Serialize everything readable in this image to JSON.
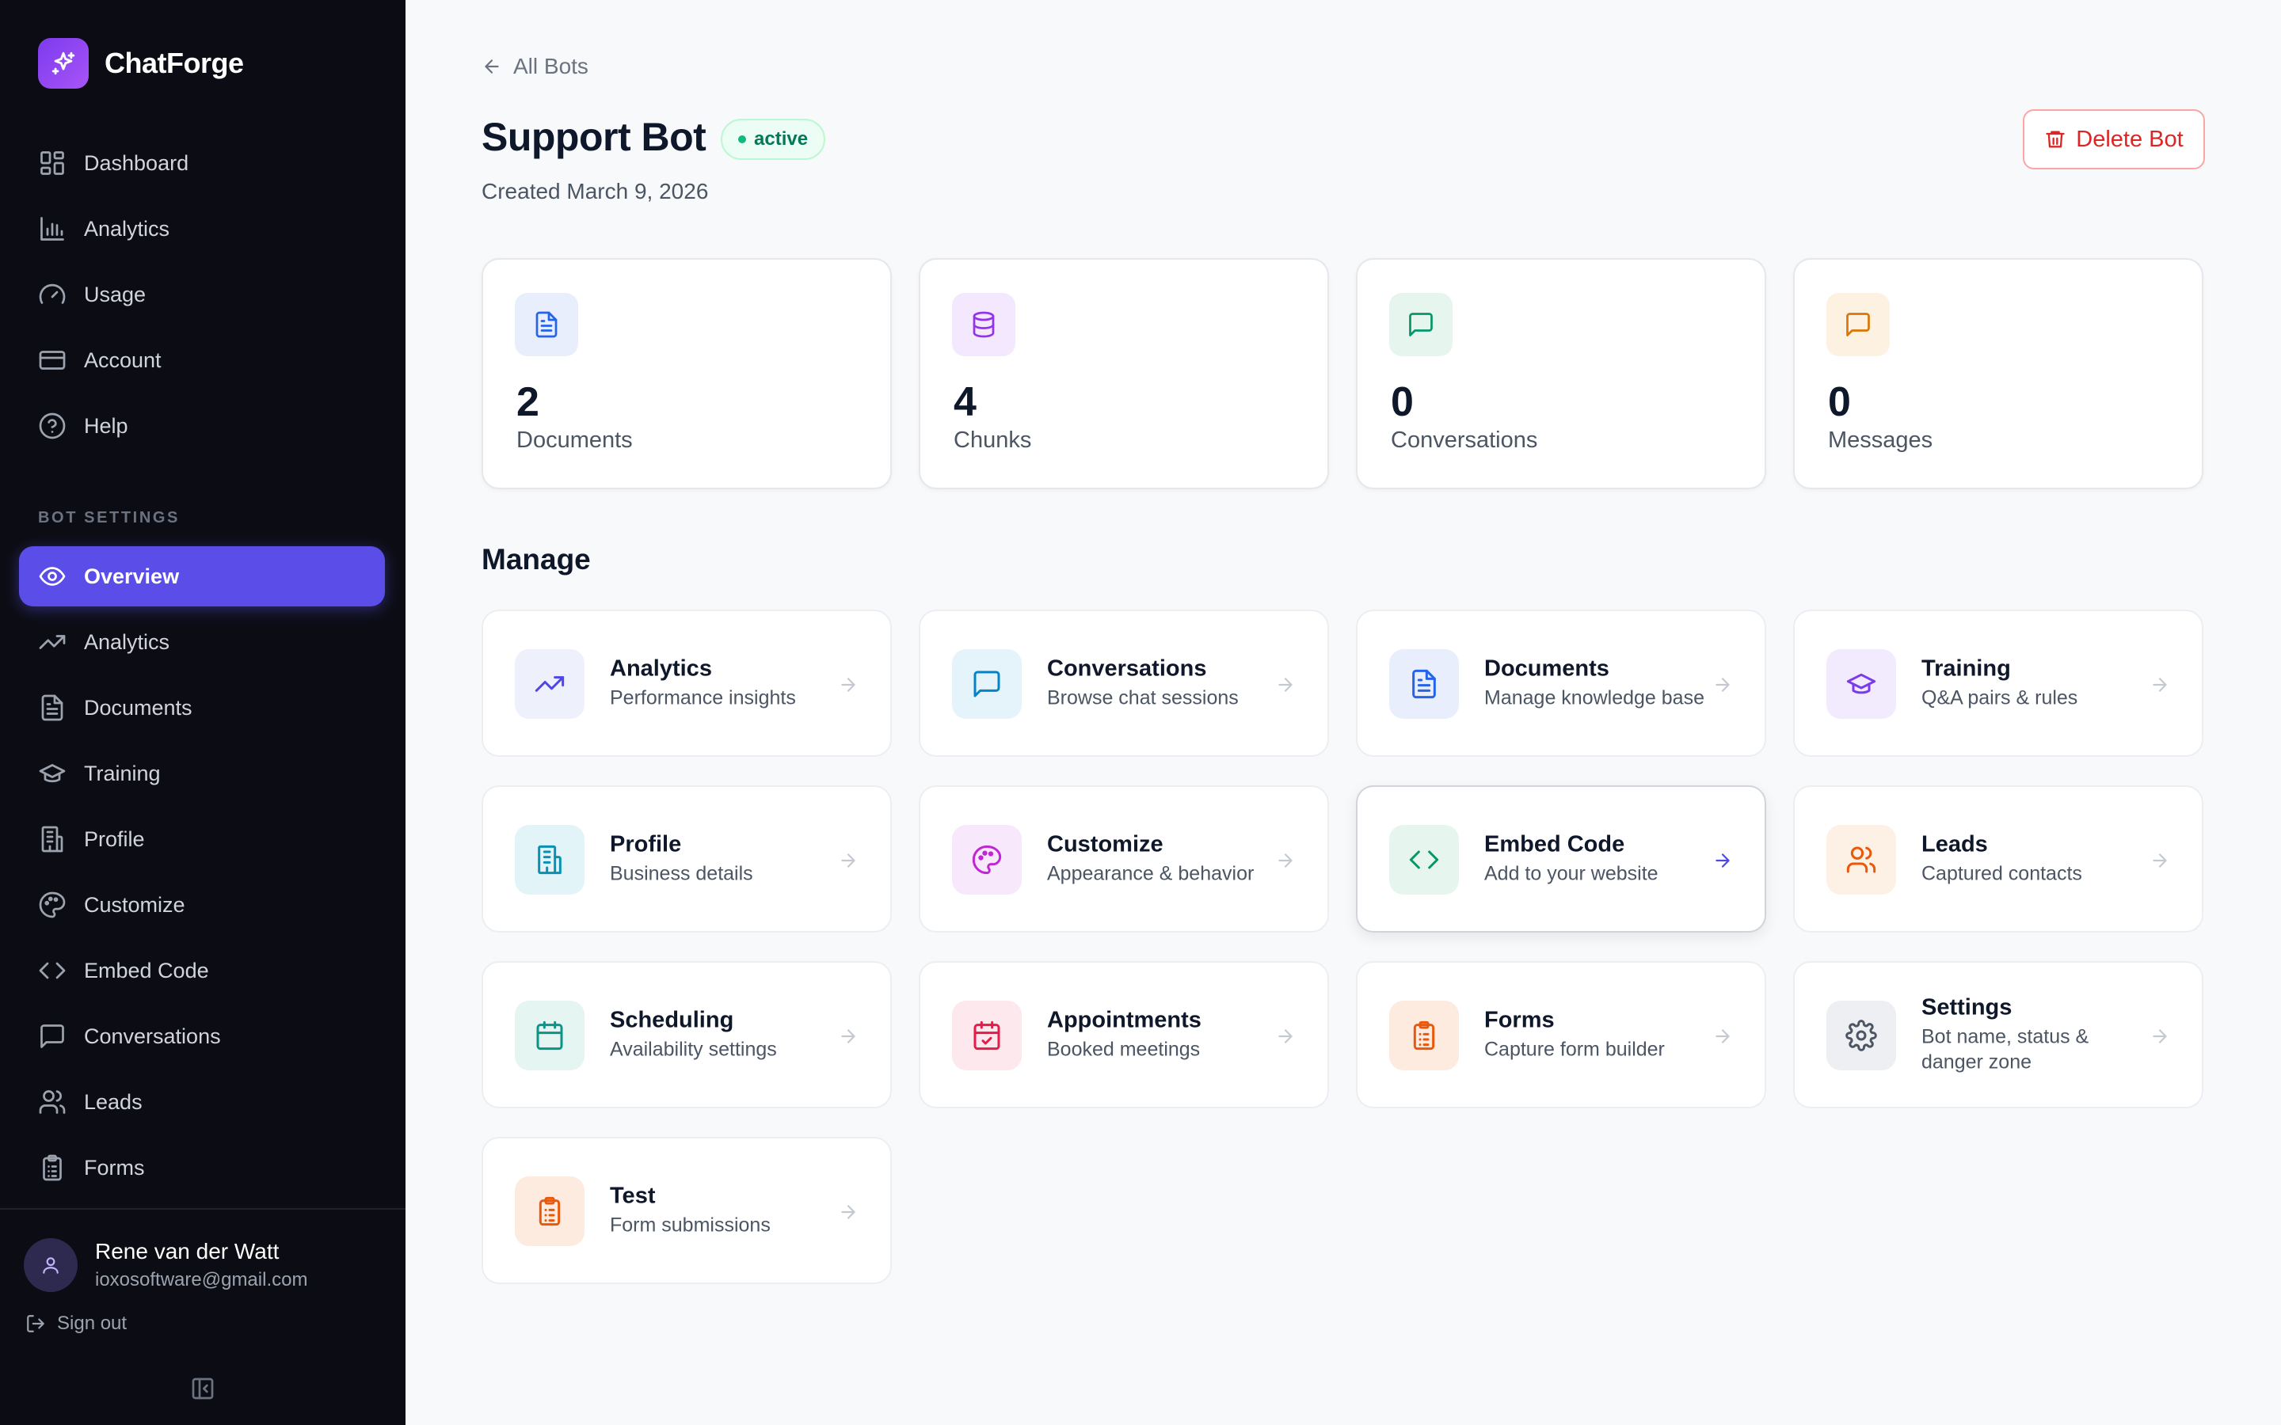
{
  "brand": {
    "name": "ChatForge"
  },
  "sidebar": {
    "top_items": [
      {
        "label": "Dashboard",
        "icon": "grid-icon"
      },
      {
        "label": "Analytics",
        "icon": "bar-chart-icon"
      },
      {
        "label": "Usage",
        "icon": "gauge-icon"
      },
      {
        "label": "Account",
        "icon": "credit-card-icon"
      },
      {
        "label": "Help",
        "icon": "help-circle-icon"
      }
    ],
    "section_label": "BOT SETTINGS",
    "bot_items": [
      {
        "label": "Overview",
        "icon": "eye-icon",
        "active": true
      },
      {
        "label": "Analytics",
        "icon": "trending-up-icon"
      },
      {
        "label": "Documents",
        "icon": "file-text-icon"
      },
      {
        "label": "Training",
        "icon": "graduation-cap-icon"
      },
      {
        "label": "Profile",
        "icon": "building-icon"
      },
      {
        "label": "Customize",
        "icon": "palette-icon"
      },
      {
        "label": "Embed Code",
        "icon": "code-icon"
      },
      {
        "label": "Conversations",
        "icon": "message-square-icon"
      },
      {
        "label": "Leads",
        "icon": "users-icon"
      },
      {
        "label": "Forms",
        "icon": "clipboard-list-icon"
      }
    ],
    "user": {
      "name": "Rene van der Watt",
      "email": "ioxosoftware@gmail.com"
    },
    "signout_label": "Sign out"
  },
  "header": {
    "back_label": "All Bots",
    "title": "Support Bot",
    "status_badge": "active",
    "created": "Created March 9, 2026",
    "delete_label": "Delete Bot"
  },
  "stats": [
    {
      "value": "2",
      "label": "Documents",
      "icon": "file-text-icon",
      "color": "#2563eb",
      "bg": "#e8eefc"
    },
    {
      "value": "4",
      "label": "Chunks",
      "icon": "database-icon",
      "color": "#9333ea",
      "bg": "#f3e8fd"
    },
    {
      "value": "0",
      "label": "Conversations",
      "icon": "message-square-icon",
      "color": "#059669",
      "bg": "#e6f6ef"
    },
    {
      "value": "0",
      "label": "Messages",
      "icon": "message-square-icon",
      "color": "#d97706",
      "bg": "#fdf1e2"
    }
  ],
  "manage": {
    "title": "Manage",
    "cards": [
      {
        "title": "Analytics",
        "sub": "Performance insights",
        "icon": "trending-up-icon",
        "color": "#4f46e5",
        "bg": "#eef0fb"
      },
      {
        "title": "Conversations",
        "sub": "Browse chat sessions",
        "icon": "message-square-icon",
        "color": "#0284c7",
        "bg": "#e5f3fb"
      },
      {
        "title": "Documents",
        "sub": "Manage knowledge base",
        "icon": "file-text-icon",
        "color": "#2563eb",
        "bg": "#e8eefc"
      },
      {
        "title": "Training",
        "sub": "Q&A pairs & rules",
        "icon": "graduation-cap-icon",
        "color": "#7c3aed",
        "bg": "#f1ebfd"
      },
      {
        "title": "Profile",
        "sub": "Business details",
        "icon": "building-icon",
        "color": "#0891b2",
        "bg": "#e3f4f8"
      },
      {
        "title": "Customize",
        "sub": "Appearance & behavior",
        "icon": "palette-icon",
        "color": "#c026d3",
        "bg": "#f7e9fb"
      },
      {
        "title": "Embed Code",
        "sub": "Add to your website",
        "icon": "code-icon",
        "color": "#059669",
        "bg": "#e6f6ef",
        "hover": true
      },
      {
        "title": "Leads",
        "sub": "Captured contacts",
        "icon": "users-icon",
        "color": "#ea580c",
        "bg": "#fdf0e4"
      },
      {
        "title": "Scheduling",
        "sub": "Availability settings",
        "icon": "calendar-icon",
        "color": "#0d9488",
        "bg": "#e4f5f2"
      },
      {
        "title": "Appointments",
        "sub": "Booked meetings",
        "icon": "calendar-check-icon",
        "color": "#e11d48",
        "bg": "#fde8ed"
      },
      {
        "title": "Forms",
        "sub": "Capture form builder",
        "icon": "clipboard-list-icon",
        "color": "#ea580c",
        "bg": "#fdebe0"
      },
      {
        "title": "Settings",
        "sub": "Bot name, status & danger zone",
        "icon": "gear-icon",
        "color": "#4b5563",
        "bg": "#eeeff2"
      },
      {
        "title": "Test",
        "sub": "Form submissions",
        "icon": "clipboard-list-icon",
        "color": "#ea580c",
        "bg": "#fdebe0"
      }
    ]
  }
}
